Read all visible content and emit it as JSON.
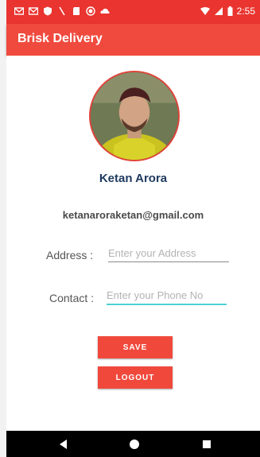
{
  "status_bar": {
    "time": "2:55",
    "icons": [
      "gmail-icon",
      "gmail-icon",
      "shield-icon",
      "slash-icon",
      "sd-card-icon",
      "record-icon",
      "cloud-icon"
    ],
    "right_icons": [
      "wifi-icon",
      "signal-icon",
      "battery-icon"
    ]
  },
  "app_bar": {
    "title": "Brisk Delivery"
  },
  "profile": {
    "name": "Ketan Arora",
    "email": "ketanaroraketan@gmail.com"
  },
  "form": {
    "address_label": "Address :",
    "address_placeholder": "Enter your Address",
    "address_value": "",
    "contact_label": "Contact :",
    "contact_placeholder": "Enter your Phone No",
    "contact_value": ""
  },
  "buttons": {
    "save": "SAVE",
    "logout": "LOGOUT"
  },
  "nav": [
    "back-icon",
    "home-icon",
    "recents-icon"
  ],
  "colors": {
    "primary": "#ef4a3d",
    "status_bar": "#e9342f",
    "accent": "#4fd0d4",
    "name": "#1e3a5f"
  }
}
